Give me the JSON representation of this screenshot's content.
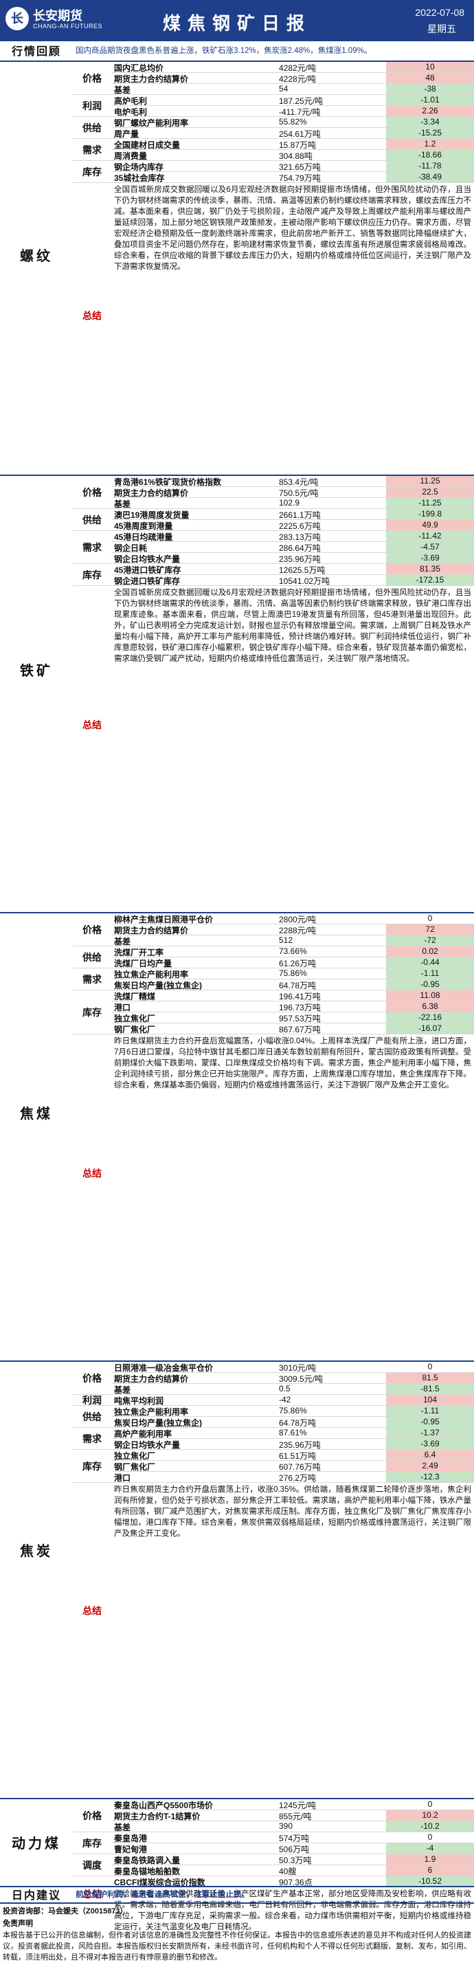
{
  "header": {
    "company_cn": "长安期货",
    "company_en": "CHANG-AN FUTURES",
    "title": "煤焦钢矿日报",
    "date": "2022-07-08",
    "weekday": "星期五",
    "brand_color": "#1f3f8a"
  },
  "review": {
    "title": "行情回顾",
    "text": "国内商品期货夜盘黑色系普遍上涨，铁矿石涨3.12%，焦炭涨2.48%，焦煤涨1.09%。"
  },
  "rebar": {
    "title": "螺纹",
    "groups": [
      {
        "label": "价格",
        "rows": [
          {
            "name": "国内汇总均价",
            "value": "4282元/吨",
            "change": "10"
          },
          {
            "name": "期货主力合约结算价",
            "value": "4228元/吨",
            "change": "48"
          },
          {
            "name": "基差",
            "value": "54",
            "change": "-38"
          }
        ]
      },
      {
        "label": "利润",
        "rows": [
          {
            "name": "高炉毛利",
            "value": "187.25元/吨",
            "change": "-1.01"
          },
          {
            "name": "电炉毛利",
            "value": "-411.7元/吨",
            "change": "2.26"
          }
        ]
      },
      {
        "label": "供给",
        "rows": [
          {
            "name": "钢厂螺纹产能利用率",
            "value": "55.82%",
            "change": "-3.34"
          },
          {
            "name": "周产量",
            "value": "254.61万吨",
            "change": "-15.25"
          }
        ]
      },
      {
        "label": "需求",
        "rows": [
          {
            "name": "全国建材日成交量",
            "value": "15.87万吨",
            "change": "1.2"
          },
          {
            "name": "周消费量",
            "value": "304.88吨",
            "change": "-18.66"
          }
        ]
      },
      {
        "label": "库存",
        "rows": [
          {
            "name": "钢企场内库存",
            "value": "321.65万吨",
            "change": "-11.78"
          },
          {
            "name": "35城社会库存",
            "value": "754.79万吨",
            "change": "-38.49"
          }
        ]
      }
    ],
    "summary_label": "总结",
    "summary": "全国百城新房成交数据回暖以及6月宏观经济数据向好预期提振市场情绪，但外围风险扰动仍存，且当下仍为钢材终端需求的传统淡季，暴雨、汛情、高温等因素仍制约螺纹终端需求释放，螺纹去库压力不减。基本面来看，供应端，钢厂仍处于亏损阶段，主动限产减产及导致上周螺纹产能利用率与螺纹周产量延续回落，加上部分地区钢铁限产政策频发，主被动限产影响下螺纹供应压力仍存。需求方面，尽管宏观经济企稳预期及低一度刺激终端补库需求，但此前房地产新开工、销售等数据同比降幅继续扩大，叠加项目资金不足问题仍然存在，影响建材需求恢复节奏，螺纹去库虽有所进展但需求疲弱格局难改。综合来看，在供应收缩的背景下螺纹去库压力仍大，短期内价格或维持低位区间运行，关注钢厂限产及下游需求恢复情况。"
  },
  "iron": {
    "title": "铁矿",
    "groups": [
      {
        "label": "价格",
        "rows": [
          {
            "name": "青岛港61%铁矿现货价格指数",
            "value": "853.4元/吨",
            "change": "11.25"
          },
          {
            "name": "期货主力合约结算价",
            "value": "750.5元/吨",
            "change": "22.5"
          },
          {
            "name": "基差",
            "value": "102.9",
            "change": "-11.25"
          }
        ]
      },
      {
        "label": "供给",
        "rows": [
          {
            "name": "澳巴19港周度发货量",
            "value": "2661.1万吨",
            "change": "-199.8"
          },
          {
            "name": "45港周度到港量",
            "value": "2225.6万吨",
            "change": "49.9"
          }
        ]
      },
      {
        "label": "需求",
        "rows": [
          {
            "name": "45港日均疏港量",
            "value": "283.13万吨",
            "change": "-11.42"
          },
          {
            "name": "钢企日耗",
            "value": "286.64万吨",
            "change": "-4.57"
          },
          {
            "name": "钢企日均铁水产量",
            "value": "235.96万吨",
            "change": "-3.69"
          }
        ]
      },
      {
        "label": "库存",
        "rows": [
          {
            "name": "45港进口铁矿库存",
            "value": "12625.5万吨",
            "change": "81.35"
          },
          {
            "name": "钢企进口铁矿库存",
            "value": "10541.02万吨",
            "change": "-172.15"
          }
        ]
      }
    ],
    "summary_label": "总结",
    "summary": "全国百城新房成交数据回暖以及6月宏观经济数据向好预期提振市场情绪，但外围风险扰动仍存，且当下仍为钢材终端需求的传统淡季，暴雨、汛情、高温等因素仍制约铁矿终端需求释放，铁矿港口库存出现累库迹象。基本面来看，供应端，尽管上周澳巴19港发货量有所回落，但45港到港量出现回升。此外，矿山已表明将全力完成发运计划，财报也显示仍有释放增量空间。需求端，上周钢厂日耗及铁水产量均有小幅下降，高炉开工率与产能利用率降低，预计终端仍难好转。钢厂利润持续低位运行，钢厂补库意愿较弱，铁矿港口库存小幅累积，钢企铁矿库存小幅下降。综合来看，铁矿现货基本面仍偏宽松，需求端仍受钢厂减产扰动，短期内价格或维持低位震荡运行，关注钢厂限产落地情况。"
  },
  "coke": {
    "title": "焦煤",
    "groups": [
      {
        "label": "价格",
        "rows": [
          {
            "name": "柳林产主焦煤日照港平仓价",
            "value": "2800元/吨",
            "change": "0"
          },
          {
            "name": "期货主力合约结算价",
            "value": "2288元/吨",
            "change": "72"
          },
          {
            "name": "基差",
            "value": "512",
            "change": "-72"
          }
        ]
      },
      {
        "label": "供给",
        "rows": [
          {
            "name": "洗煤厂开工率",
            "value": "73.66%",
            "change": "0.02"
          },
          {
            "name": "洗煤厂日均产量",
            "value": "61.26万吨",
            "change": "-0.44"
          }
        ]
      },
      {
        "label": "需求",
        "rows": [
          {
            "name": "独立焦企产能利用率",
            "value": "75.86%",
            "change": "-1.11"
          },
          {
            "name": "焦炭日均产量(独立焦企)",
            "value": "64.78万吨",
            "change": "-0.95"
          }
        ]
      },
      {
        "label": "库存",
        "rows": [
          {
            "name": "洗煤厂精煤",
            "value": "196.41万吨",
            "change": "11.08"
          },
          {
            "name": "港口",
            "value": "196.73万吨",
            "change": "6.38"
          },
          {
            "name": "独立焦化厂",
            "value": "957.53万吨",
            "change": "-22.16"
          },
          {
            "name": "钢厂焦化厂",
            "value": "867.67万吨",
            "change": "-16.07"
          }
        ]
      }
    ],
    "summary_label": "总结",
    "summary": "昨日焦煤期货主力合约开盘后宽幅震荡，小幅收涨0.04%。上周样本洗煤厂产能有所上涨，进口方面，7月6日进口蒙煤，乌拉特中旗甘其毛都口岸日通关车数较前期有所回升，蒙古国防疫政策有所调整。受前期煤价大幅下跌影响，蒙煤、口岸焦煤成交价格均有下调。需求方面，焦企产能利用率小幅下降，焦企利润持续亏损，部分焦企已开始实施限产。库存方面，上周焦煤港口库存增加，焦企焦煤库存下降。综合来看，焦煤基本面仍偏弱，短期内价格或维持震荡运行，关注下游钢厂限产及焦企开工变化。"
  },
  "coal": {
    "title": "焦炭",
    "groups": [
      {
        "label": "价格",
        "rows": [
          {
            "name": "日照港准一级冶金焦平仓价",
            "value": "3010元/吨",
            "change": "0"
          },
          {
            "name": "期货主力合约结算价",
            "value": "3009.5元/吨",
            "change": "81.5"
          },
          {
            "name": "基差",
            "value": "0.5",
            "change": "-81.5"
          }
        ]
      },
      {
        "label": "利润",
        "rows": [
          {
            "name": "吨焦平均利润",
            "value": "-42",
            "change": "104"
          }
        ]
      },
      {
        "label": "供给",
        "rows": [
          {
            "name": "独立焦企产能利用率",
            "value": "75.86%",
            "change": "-1.11"
          },
          {
            "name": "焦炭日均产量(独立焦企)",
            "value": "64.78万吨",
            "change": "-0.95"
          }
        ]
      },
      {
        "label": "需求",
        "rows": [
          {
            "name": "高炉产能利用率",
            "value": "87.61%",
            "change": "-1.37"
          },
          {
            "name": "钢企日均铁水产量",
            "value": "235.96万吨",
            "change": "-3.69"
          }
        ]
      },
      {
        "label": "库存",
        "rows": [
          {
            "name": "独立焦化厂",
            "value": "61.51万吨",
            "change": "6.4"
          },
          {
            "name": "钢厂焦化厂",
            "value": "607.76万吨",
            "change": "2.49"
          },
          {
            "name": "港口",
            "value": "276.2万吨",
            "change": "-12.3"
          }
        ]
      }
    ],
    "summary_label": "总结",
    "summary": "昨日焦炭期货主力合约开盘后震荡上行，收涨0.35%。供给端，随着焦煤第二轮降价逐步落地，焦企利润有所修复，但仍处于亏损状态，部分焦企开工率较低。需求端，高炉产能利用率小幅下降，铁水产量有所回落，钢厂减产范围扩大，对焦炭需求形成压制。库存方面，独立焦化厂及钢厂焦化厂焦炭库存小幅增加，港口库存下降。综合来看，焦炭供需双弱格局延续，短期内价格或维持震荡运行，关注钢厂限产及焦企开工变化。"
  },
  "thermal": {
    "title": "动力煤",
    "groups": [
      {
        "label": "价格",
        "rows": [
          {
            "name": "秦皇岛山西产Q5500市场价",
            "value": "1245元/吨",
            "change": "0"
          },
          {
            "name": "期货主力合约T-1结算价",
            "value": "855元/吨",
            "change": "10.2"
          },
          {
            "name": "基差",
            "value": "390",
            "change": "-10.2"
          }
        ]
      },
      {
        "label": "库存",
        "rows": [
          {
            "name": "秦皇岛港",
            "value": "574万吨",
            "change": "0"
          },
          {
            "name": "曹妃甸港",
            "value": "506万吨",
            "change": "-4"
          }
        ]
      },
      {
        "label": "调度",
        "rows": [
          {
            "name": "秦皇岛铁路调入量",
            "value": "50.3万吨",
            "change": "1.9"
          },
          {
            "name": "秦皇岛锚地船舶数",
            "value": "40艘",
            "change": "6"
          }
        ]
      },
      {
        "label": "",
        "rows": [
          {
            "name": "CBCFI煤炭综合运价指数",
            "value": "907.36点",
            "change": "-10.52"
          }
        ]
      }
    ],
    "summary_label": "总结",
    "summary": "供给端来看，产地保供政策延续，主产区煤矿生产基本正常，部分地区受降雨及安检影响，供应略有收紧。需求端，随着夏季用电高峰来临，电厂日耗有所回升，非电端需求偏弱。库存方面，港口库存维持高位，下游电厂库存充足，采购需求一般。综合来看，动力煤市场供需相对平衡，短期内价格或维持稳定运行，关注气温变化及电厂日耗情况。"
  },
  "advice": {
    "title": "日内建议",
    "text": "前空保护利润，逢进者逢高试空，注意止盈止损。"
  },
  "footer": {
    "advisor": "投资咨询部：马会媛夫（Z0015873）",
    "disclaimer_title": "免责声明",
    "disclaimer": "本报告基于已公开的信息编制，但作者对该信息的准确性及完整性不作任何保证。本报告中的信息或所表述的意见并不构成对任何人的投资建议，投资者据此投资，风险自担。本报告版权归长安期货所有，未经书面许可，任何机构和个人不得以任何形式翻版、复制、发布，如引用、转载，须注明出处，且不得对本报告进行有悖原意的删节和修改。"
  },
  "colors": {
    "pos": "#f4c7c3",
    "neg": "#c6e5c6"
  }
}
